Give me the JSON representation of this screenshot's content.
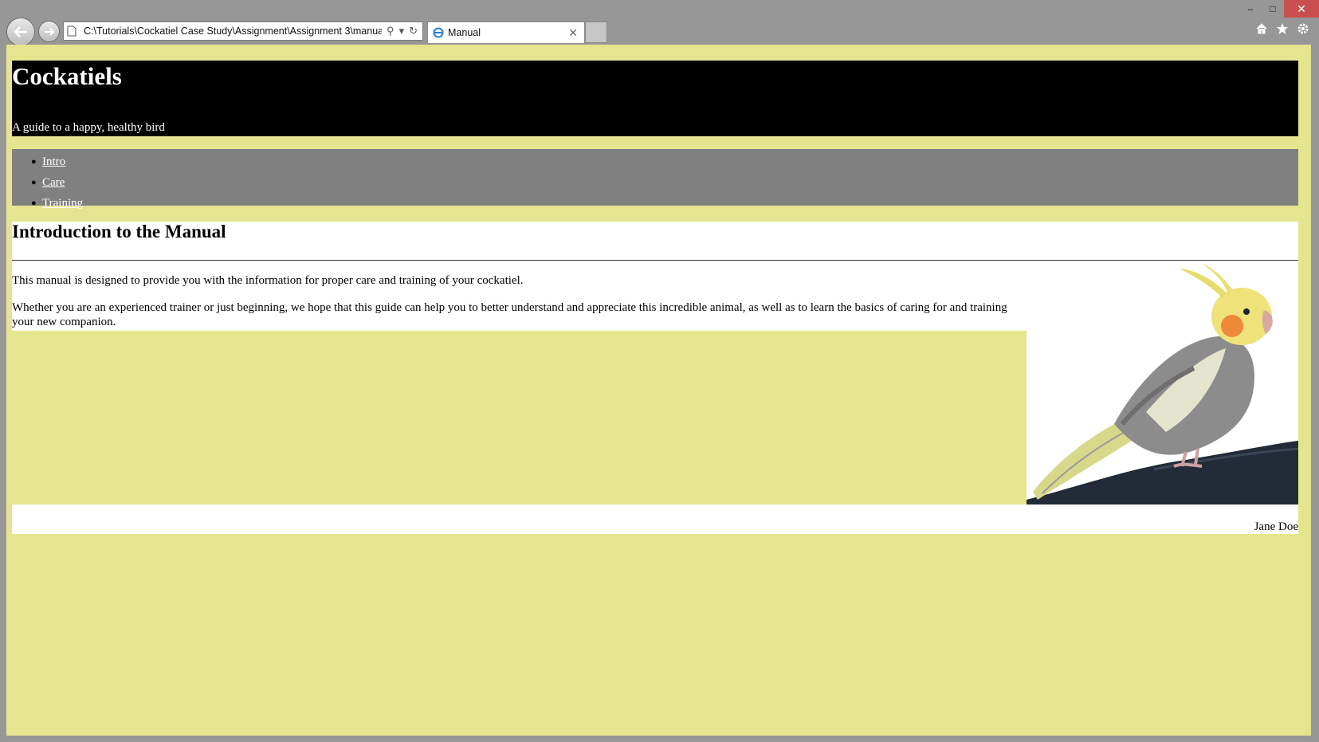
{
  "browser": {
    "address": "C:\\Tutorials\\Cockatiel Case Study\\Assignment\\Assignment 3\\manual.l",
    "tab_title": "Manual",
    "window_controls": [
      "minimize",
      "maximize",
      "close"
    ],
    "tools": [
      "home-icon",
      "favorites-star-icon",
      "settings-gear-icon"
    ]
  },
  "header": {
    "title": "Cockatiels",
    "tagline": "A guide to a happy, healthy bird"
  },
  "nav": {
    "items": [
      {
        "label": "Intro"
      },
      {
        "label": "Care"
      },
      {
        "label": "Training"
      }
    ]
  },
  "section": {
    "heading": "Introduction to the Manual",
    "paragraphs": [
      "This manual is designed to provide you with the information for proper care and training of your cockatiel.",
      "Whether you are an experienced trainer or just beginning, we hope that this guide can help you to better understand and appreciate this incredible animal, as well as to learn the basics of caring for and training your new companion."
    ]
  },
  "footer": {
    "author": "Jane Doe"
  },
  "colors": {
    "page_background": "#e5e58f",
    "header_background": "#000000",
    "nav_background": "#808080",
    "close_button": "#c94f4f"
  }
}
